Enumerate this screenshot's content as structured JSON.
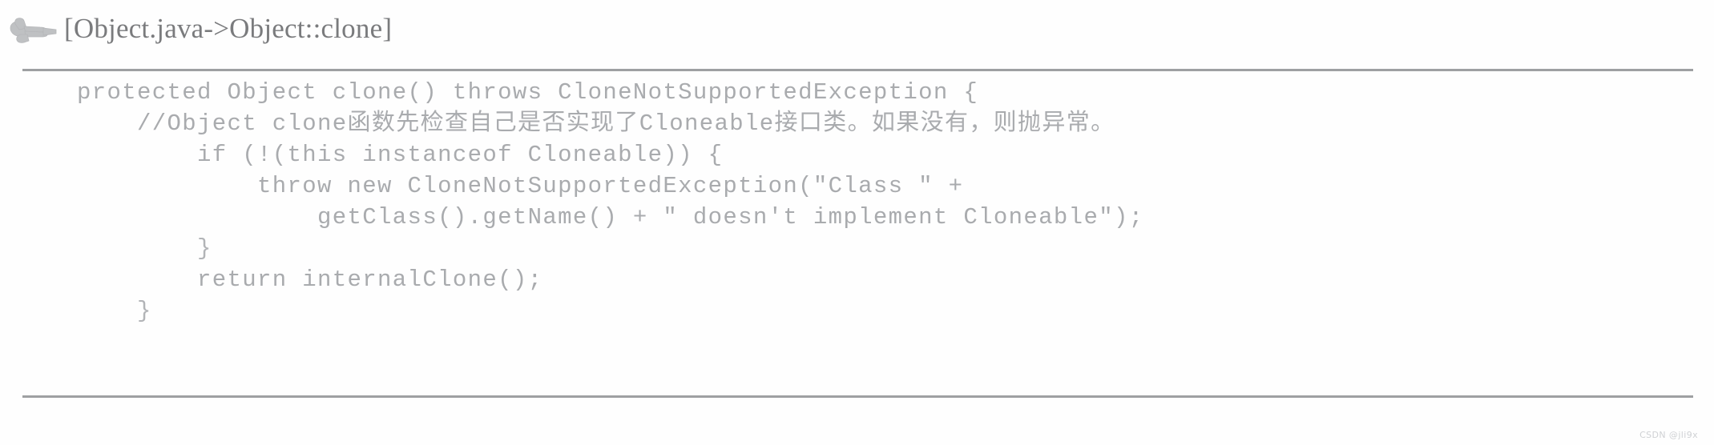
{
  "header": {
    "icon": "pointing-hand-icon",
    "title": "[Object.java->Object::clone]"
  },
  "code": {
    "language": "java",
    "lines": [
      "protected Object clone() throws CloneNotSupportedException {",
      "    //Object clone函数先检查自己是否实现了Cloneable接口类。如果没有，则抛异常。",
      "        if (!(this instanceof Cloneable)) {",
      "            throw new CloneNotSupportedException(\"Class \" +",
      "                getClass().getName() + \" doesn't implement Cloneable\");",
      "        }",
      "        return internalClone();",
      "    }"
    ]
  },
  "watermark": {
    "text": "CSDN @jli9x"
  },
  "colors": {
    "text": "#a9abae",
    "title": "#6f7073",
    "rule": "#8d8f92",
    "background": "#fefefe",
    "watermark": "#cfd1d4"
  }
}
